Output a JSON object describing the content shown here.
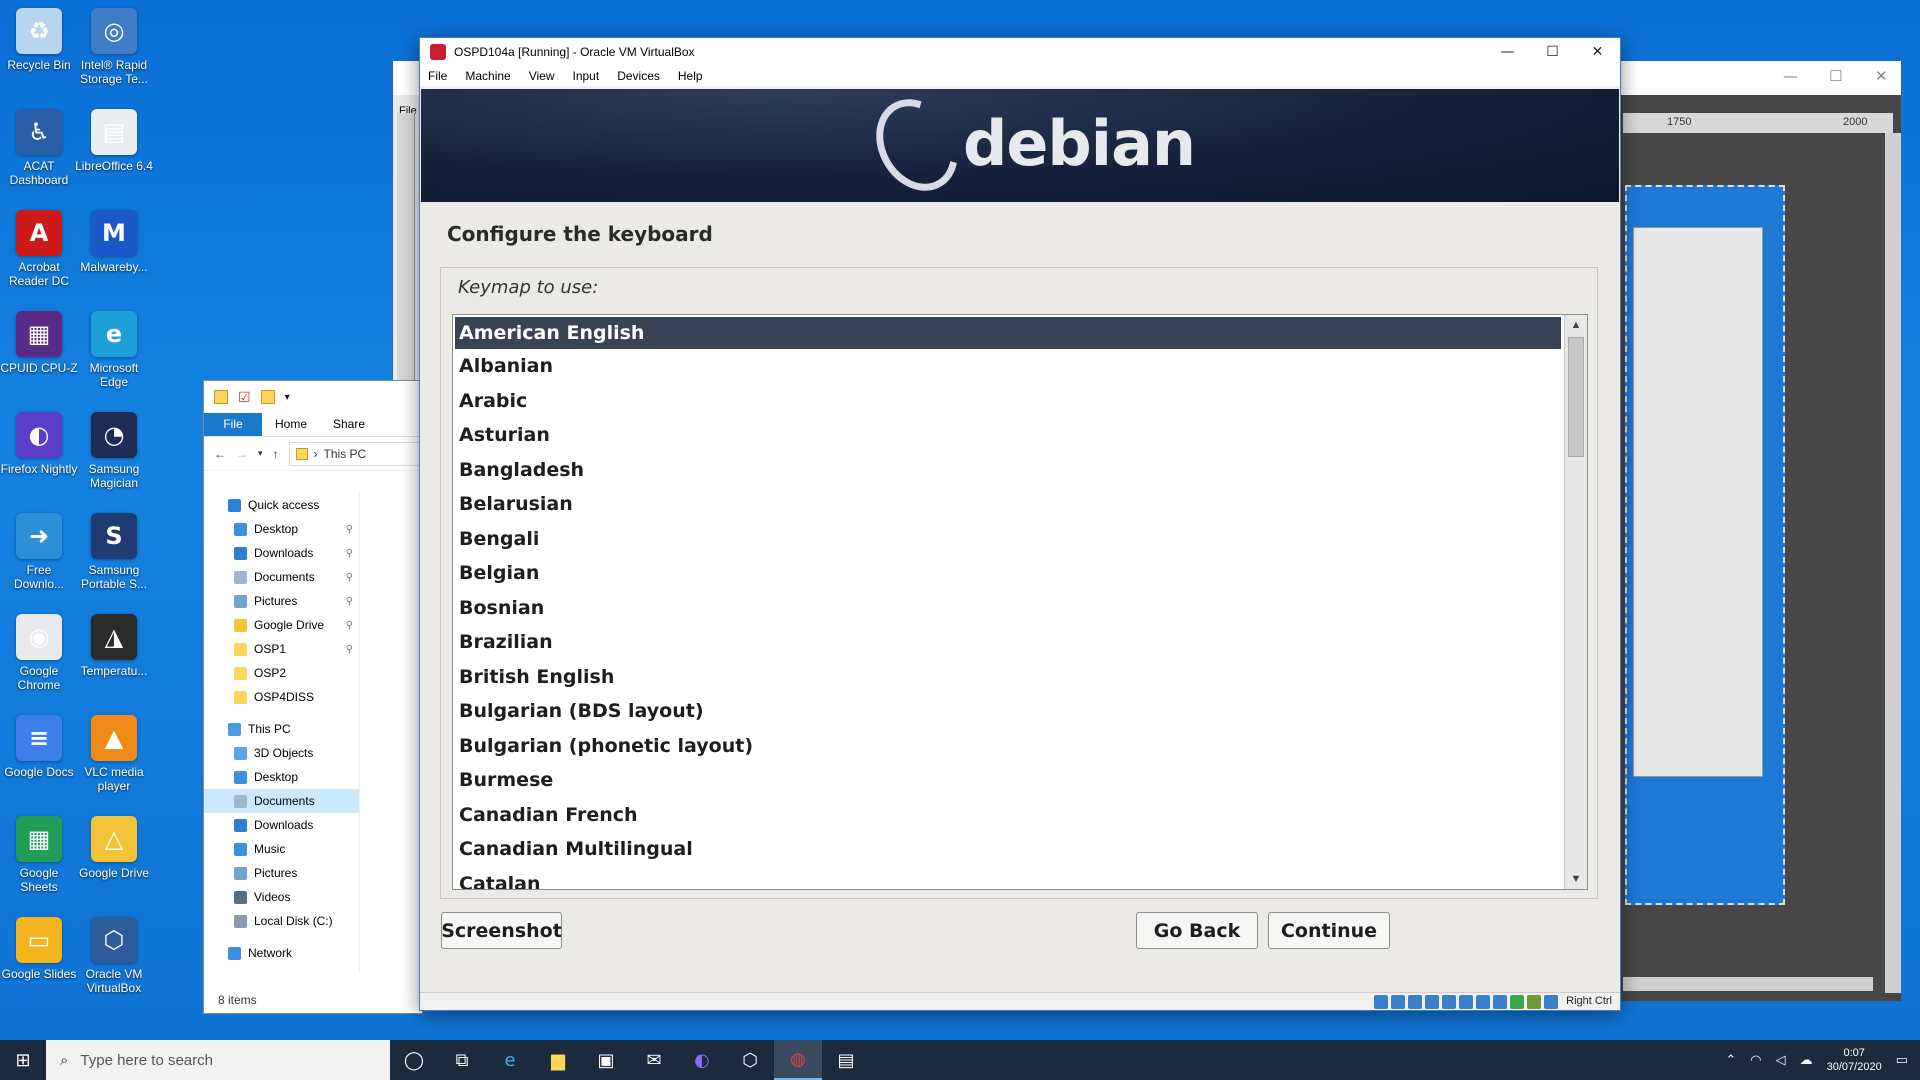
{
  "desktop_icons": [
    {
      "label": "Recycle Bin",
      "icon": "recycle-bin-icon",
      "color": "#b8d4ef",
      "glyph": "♻"
    },
    {
      "label": "Intel® Rapid Storage Te...",
      "icon": "intel-rst-icon",
      "color": "#3f7cc5",
      "glyph": "◎"
    },
    {
      "label": "ACAT Dashboard",
      "icon": "acat-icon",
      "color": "#2a5fa8",
      "glyph": "♿"
    },
    {
      "label": "LibreOffice 6.4",
      "icon": "libreoffice-icon",
      "color": "#e9eef3",
      "glyph": "▤"
    },
    {
      "label": "Acrobat Reader DC",
      "icon": "acrobat-icon",
      "color": "#cc1a1a",
      "glyph": "A"
    },
    {
      "label": "Malwareby...",
      "icon": "malwarebytes-icon",
      "color": "#1a57c9",
      "glyph": "M"
    },
    {
      "label": "CPUID CPU-Z",
      "icon": "cpuz-icon",
      "color": "#5b2a86",
      "glyph": "▦"
    },
    {
      "label": "Microsoft Edge",
      "icon": "edge-icon",
      "color": "#1f9fd8",
      "glyph": "e"
    },
    {
      "label": "Firefox Nightly",
      "icon": "firefox-nightly-icon",
      "color": "#5a3ec8",
      "glyph": "◐"
    },
    {
      "label": "Samsung Magician",
      "icon": "samsung-magician-icon",
      "color": "#1d2c54",
      "glyph": "◔"
    },
    {
      "label": "Free Downlo...",
      "icon": "free-download-icon",
      "color": "#2d8fd6",
      "glyph": "➜"
    },
    {
      "label": "Samsung Portable S...",
      "icon": "samsung-portable-ssd-icon",
      "color": "#203a72",
      "glyph": "S"
    },
    {
      "label": "Google Chrome",
      "icon": "chrome-icon",
      "color": "#e8eaed",
      "glyph": "◉"
    },
    {
      "label": "Temperatu...",
      "icon": "temperature-icon",
      "color": "#2b2b2b",
      "glyph": "◮"
    },
    {
      "label": "Google Docs",
      "icon": "google-docs-icon",
      "color": "#3d7ee8",
      "glyph": "≡"
    },
    {
      "label": "VLC media player",
      "icon": "vlc-icon",
      "color": "#f08a18",
      "glyph": "▲"
    },
    {
      "label": "Google Sheets",
      "icon": "google-sheets-icon",
      "color": "#1f9e58",
      "glyph": "▦"
    },
    {
      "label": "Google Drive",
      "icon": "google-drive-icon",
      "color": "#f3c339",
      "glyph": "△"
    },
    {
      "label": "Google Slides",
      "icon": "google-slides-icon",
      "color": "#f2b51f",
      "glyph": "▭"
    },
    {
      "label": "Oracle VM VirtualBox",
      "icon": "virtualbox-icon",
      "color": "#2d5b9c",
      "glyph": "⬡"
    }
  ],
  "explorer": {
    "tabs": [
      "File",
      "Home",
      "Share"
    ],
    "path": "This PC",
    "nav": [
      {
        "label": "Quick access",
        "icon": "star-icon",
        "color": "#2f83d6",
        "indent": 0,
        "pinned": false,
        "selected": false
      },
      {
        "label": "Desktop",
        "icon": "desktop-folder-icon",
        "color": "#3d8fde",
        "indent": 1,
        "pinned": true,
        "selected": false
      },
      {
        "label": "Downloads",
        "icon": "downloads-folder-icon",
        "color": "#2f7fd1",
        "indent": 1,
        "pinned": true,
        "selected": false
      },
      {
        "label": "Documents",
        "icon": "documents-folder-icon",
        "color": "#9db6cf",
        "indent": 1,
        "pinned": true,
        "selected": false
      },
      {
        "label": "Pictures",
        "icon": "pictures-folder-icon",
        "color": "#6ea3d3",
        "indent": 1,
        "pinned": true,
        "selected": false
      },
      {
        "label": "Google Drive",
        "icon": "google-drive-folder-icon",
        "color": "#f3c339",
        "indent": 1,
        "pinned": true,
        "selected": false
      },
      {
        "label": "OSP1",
        "icon": "folder-icon",
        "color": "#ffd55a",
        "indent": 1,
        "pinned": true,
        "selected": false
      },
      {
        "label": "OSP2",
        "icon": "folder-icon",
        "color": "#ffd55a",
        "indent": 1,
        "pinned": false,
        "selected": false
      },
      {
        "label": "OSP4DISS",
        "icon": "folder-icon",
        "color": "#ffd55a",
        "indent": 1,
        "pinned": false,
        "selected": false
      },
      {
        "label": "This PC",
        "icon": "this-pc-icon",
        "color": "#4a9be3",
        "indent": 0,
        "pinned": false,
        "selected": false
      },
      {
        "label": "3D Objects",
        "icon": "3d-objects-icon",
        "color": "#58a6e8",
        "indent": 1,
        "pinned": false,
        "selected": false
      },
      {
        "label": "Desktop",
        "icon": "desktop-folder-icon",
        "color": "#3d8fde",
        "indent": 1,
        "pinned": false,
        "selected": false
      },
      {
        "label": "Documents",
        "icon": "documents-folder-icon",
        "color": "#9db6cf",
        "indent": 1,
        "pinned": false,
        "selected": true
      },
      {
        "label": "Downloads",
        "icon": "downloads-folder-icon",
        "color": "#2f7fd1",
        "indent": 1,
        "pinned": false,
        "selected": false
      },
      {
        "label": "Music",
        "icon": "music-folder-icon",
        "color": "#3d8fde",
        "indent": 1,
        "pinned": false,
        "selected": false
      },
      {
        "label": "Pictures",
        "icon": "pictures-folder-icon",
        "color": "#6ea3d3",
        "indent": 1,
        "pinned": false,
        "selected": false
      },
      {
        "label": "Videos",
        "icon": "videos-folder-icon",
        "color": "#5a6b84",
        "indent": 1,
        "pinned": false,
        "selected": false
      },
      {
        "label": "Local Disk (C:)",
        "icon": "disk-icon",
        "color": "#8a9bb0",
        "indent": 1,
        "pinned": false,
        "selected": false
      },
      {
        "label": "Network",
        "icon": "network-icon",
        "color": "#3d8fde",
        "indent": 0,
        "pinned": false,
        "selected": false
      }
    ],
    "status": "8 items"
  },
  "bg_window": {
    "menu_label": "File",
    "ruler_labels": [
      "1750",
      "2000"
    ]
  },
  "vbox": {
    "title": "OSPD104a [Running] - Oracle VM VirtualBox",
    "menu": [
      "File",
      "Machine",
      "View",
      "Input",
      "Devices",
      "Help"
    ],
    "window_buttons": {
      "minimize": "—",
      "maximize": "☐",
      "close": "✕"
    },
    "host_key": "Right Ctrl"
  },
  "installer": {
    "logo_text": "debian",
    "step_title": "Configure the keyboard",
    "prompt": "Keymap to use:",
    "keymaps": [
      "American English",
      "Albanian",
      "Arabic",
      "Asturian",
      "Bangladesh",
      "Belarusian",
      "Bengali",
      "Belgian",
      "Bosnian",
      "Brazilian",
      "British English",
      "Bulgarian (BDS layout)",
      "Bulgarian (phonetic layout)",
      "Burmese",
      "Canadian French",
      "Canadian Multilingual",
      "Catalan"
    ],
    "selected_index": 0,
    "buttons": {
      "screenshot": "Screenshot",
      "go_back": "Go Back",
      "continue": "Continue"
    }
  },
  "taskbar": {
    "search_placeholder": "Type here to search",
    "clock_time": "0:07",
    "clock_date": "30/07/2020",
    "accent": "#76b9ed"
  }
}
